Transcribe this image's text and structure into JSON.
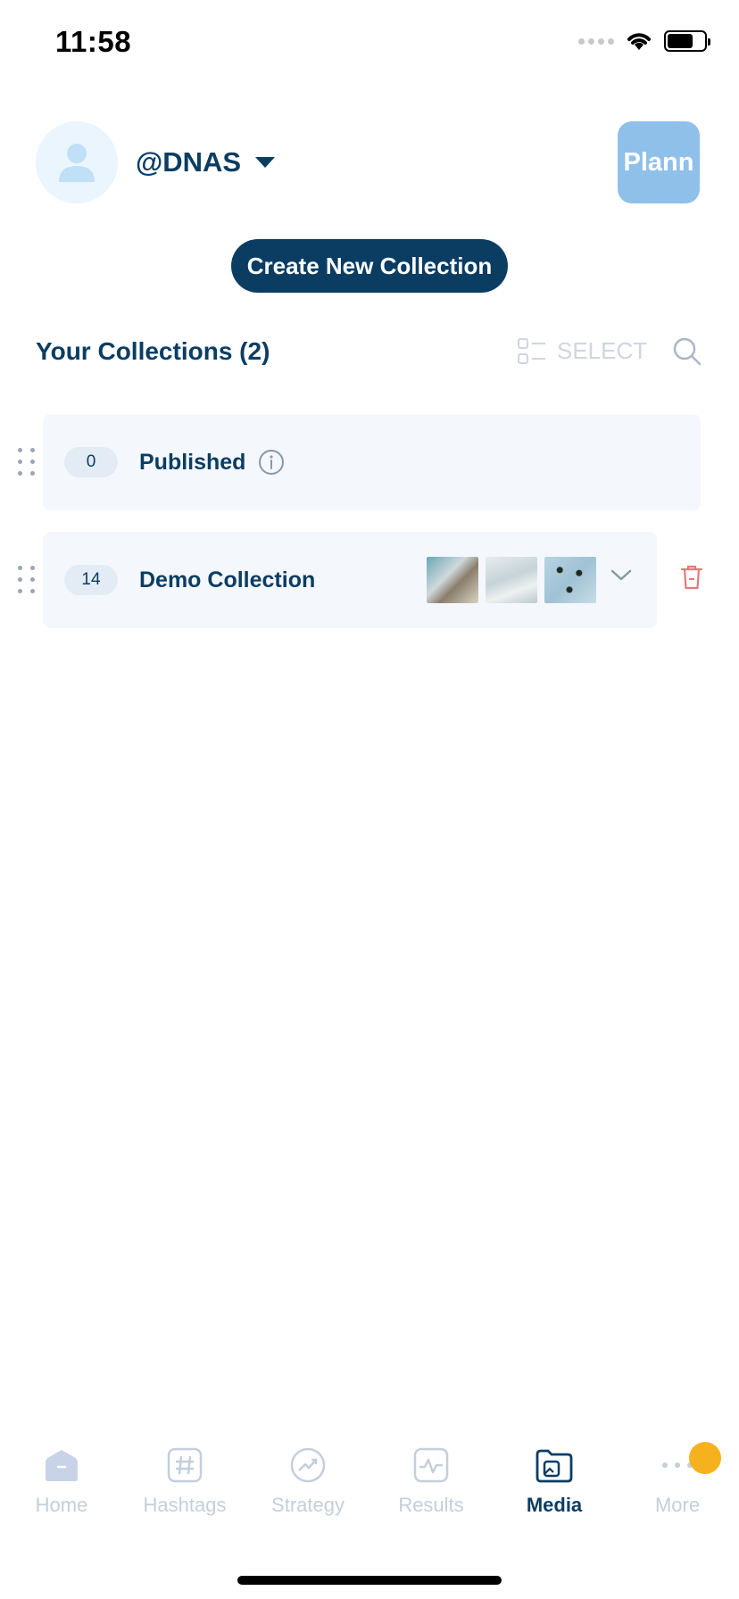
{
  "status_bar": {
    "time": "11:58"
  },
  "header": {
    "account_name": "@DNAS",
    "plann_button": "Plann",
    "create_button": "Create New Collection"
  },
  "collections": {
    "title": "Your Collections (2)",
    "select_label": "SELECT",
    "items": [
      {
        "count": "0",
        "name": "Published"
      },
      {
        "count": "14",
        "name": "Demo Collection"
      }
    ]
  },
  "tabbar": {
    "tabs": [
      {
        "label": "Home",
        "icon": "home-icon"
      },
      {
        "label": "Hashtags",
        "icon": "hashtag-icon"
      },
      {
        "label": "Strategy",
        "icon": "strategy-icon"
      },
      {
        "label": "Results",
        "icon": "results-icon"
      },
      {
        "label": "Media",
        "icon": "media-icon"
      },
      {
        "label": "More",
        "icon": "more-icon"
      }
    ],
    "active": "Media"
  },
  "colors": {
    "primary": "#0b3d63",
    "plann_button": "#8fc0ea",
    "row_bg": "#f4f8fd",
    "trash": "#e27b7b",
    "badge": "#f6b21e",
    "inactive": "#c3cfdc"
  }
}
